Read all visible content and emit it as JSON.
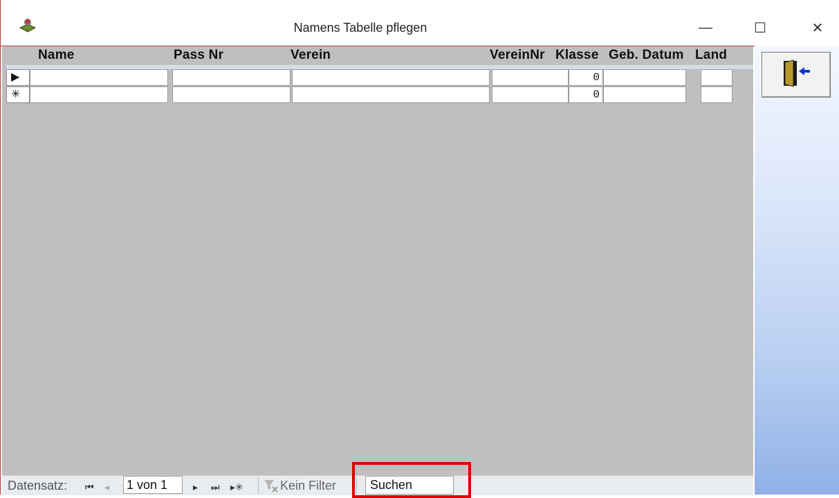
{
  "window": {
    "title": "Namens Tabelle pflegen",
    "minimize": "—",
    "maximize": "☐",
    "close": "✕"
  },
  "table": {
    "columns": [
      "Name",
      "Pass Nr",
      "Verein",
      "VereinNr",
      "Klasse",
      "Geb. Datum",
      "Land"
    ],
    "rows": [
      {
        "selector": "▶",
        "name": "",
        "pass_nr": "",
        "verein": "",
        "verein_nr": "",
        "klasse": "0",
        "geb_datum": "",
        "land": ""
      },
      {
        "selector": "✳",
        "name": "",
        "pass_nr": "",
        "verein": "",
        "verein_nr": "",
        "klasse": "0",
        "geb_datum": "",
        "land": ""
      }
    ]
  },
  "statusbar": {
    "label": "Datensatz:",
    "first": "⏮",
    "prev": "◂",
    "record": "1 von 1",
    "next": "▸",
    "last": "⏭",
    "new": "▸✳",
    "filter": "Kein Filter",
    "search": "Suchen"
  },
  "colors": {
    "grid_background": "#bfbfbf",
    "highlight": "#e00000"
  }
}
